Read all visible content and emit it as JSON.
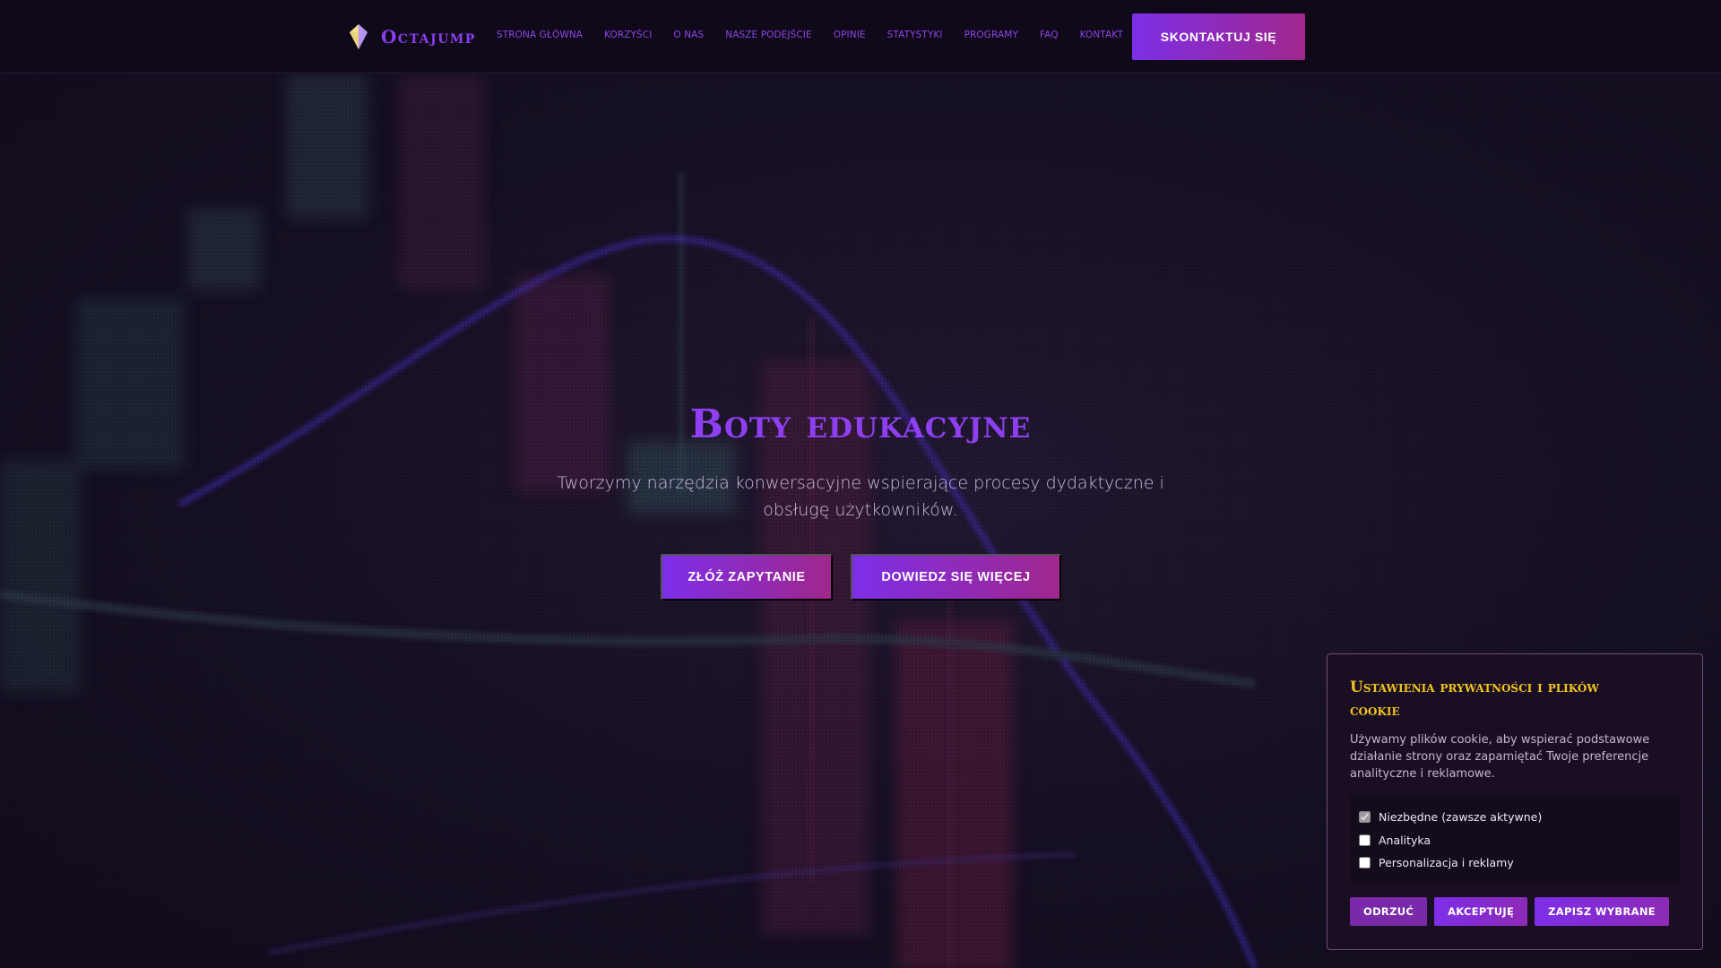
{
  "brand": {
    "name": "Octajump",
    "accent": "#8a3ff0",
    "logo_icon": "diamond-logo-icon"
  },
  "nav": {
    "items": [
      {
        "label": "STRONA GŁÓWNA"
      },
      {
        "label": "KORZYŚCI"
      },
      {
        "label": "O NAS"
      },
      {
        "label": "NASZE PODEJŚCIE"
      },
      {
        "label": "OPINIE"
      },
      {
        "label": "STATYSTYKI"
      },
      {
        "label": "PROGRAMY"
      },
      {
        "label": "FAQ"
      },
      {
        "label": "KONTAKT"
      }
    ],
    "cta_label": "SKONTAKTUJ SIĘ"
  },
  "hero": {
    "title": "Boty edukacyjne",
    "subtitle": "Tworzymy narzędzia konwersacyjne wspierające procesy dydaktyczne i obsługę użytkowników.",
    "primary_button": "ZŁÓŻ ZAPYTANIE",
    "secondary_button": "DOWIEDZ SIĘ WIĘCEJ"
  },
  "cookie": {
    "title": "Ustawienia prywatności i plików cookie",
    "text": "Używamy plików cookie, aby wspierać podstawowe działanie strony oraz zapamiętać Twoje preferencje analityczne i reklamowe.",
    "options": [
      {
        "label": "Niezbędne (zawsze aktywne)",
        "checked": true,
        "disabled": true
      },
      {
        "label": "Analityka",
        "checked": false,
        "disabled": false
      },
      {
        "label": "Personalizacja i reklamy",
        "checked": false,
        "disabled": false
      }
    ],
    "buttons": {
      "reject": "ODRZUĆ",
      "accept": "AKCEPTUJĘ",
      "save": "ZAPISZ WYBRANE"
    },
    "title_color": "#f1c41f"
  }
}
